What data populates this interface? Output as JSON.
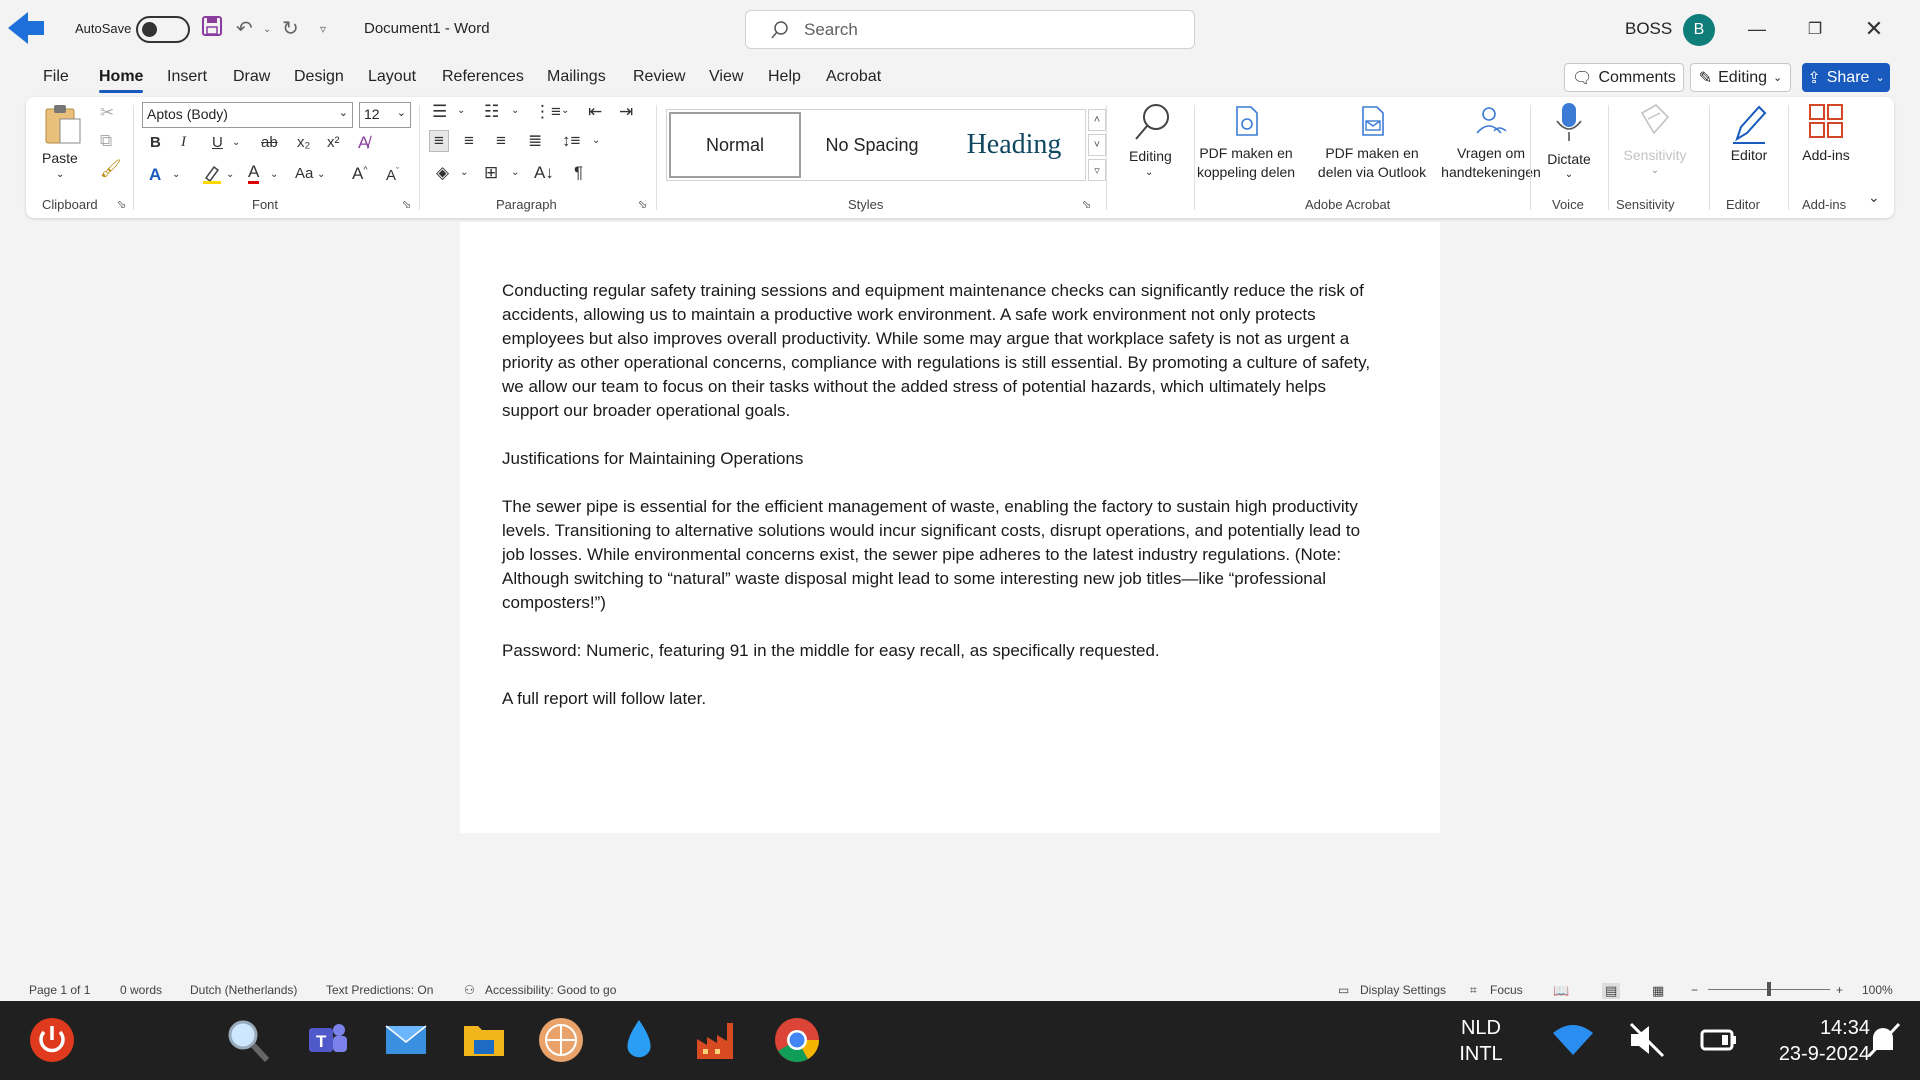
{
  "app": {
    "autosave_label": "AutoSave",
    "doc_title": "Document1  -  Word",
    "search_placeholder": "Search",
    "user_name": "BOSS",
    "user_initial": "B"
  },
  "menu": {
    "tabs": [
      "File",
      "Home",
      "Insert",
      "Draw",
      "Design",
      "Layout",
      "References",
      "Mailings",
      "Review",
      "View",
      "Help",
      "Acrobat"
    ],
    "active_tab": "Home",
    "comments_label": "Comments",
    "editing_label": "Editing",
    "share_label": "Share"
  },
  "ribbon": {
    "clipboard": {
      "paste_label": "Paste",
      "group_label": "Clipboard"
    },
    "font": {
      "font_name": "Aptos (Body)",
      "font_size": "12",
      "group_label": "Font",
      "change_case": "Aa"
    },
    "paragraph": {
      "group_label": "Paragraph"
    },
    "styles": {
      "items": [
        "Normal",
        "No Spacing",
        "Heading"
      ],
      "group_label": "Styles"
    },
    "editing": {
      "label": "Editing"
    },
    "acrobat": {
      "btn1_line1": "PDF maken en",
      "btn1_line2": "koppeling delen",
      "btn2_line1": "PDF maken en",
      "btn2_line2": "delen via Outlook",
      "btn3_line1": "Vragen om",
      "btn3_line2": "handtekeningen",
      "group_label": "Adobe Acrobat"
    },
    "voice": {
      "dictate_label": "Dictate",
      "group_label": "Voice"
    },
    "sensitivity": {
      "label": "Sensitivity",
      "group_label": "Sensitivity"
    },
    "editor": {
      "label": "Editor",
      "group_label": "Editor"
    },
    "addins": {
      "label": "Add-ins",
      "group_label": "Add-ins"
    }
  },
  "document": {
    "paragraphs": [
      "Conducting regular safety training sessions and equipment maintenance checks can significantly reduce the risk of accidents, allowing us to maintain a productive work environment. A safe work environment not only protects employees but also improves overall productivity. While some may argue that workplace safety is not as urgent a priority as other operational concerns, compliance with regulations is still essential. By promoting a culture of safety, we allow our team to focus on their tasks without the added stress of potential hazards, which ultimately helps support our broader operational goals.",
      "Justifications for Maintaining Operations",
      "The sewer pipe is essential for the efficient management of waste, enabling the factory to sustain high productivity levels. Transitioning to alternative solutions would incur significant costs, disrupt operations, and potentially lead to job losses. While environmental concerns exist, the sewer pipe adheres to the latest industry regulations. (Note: Although switching to “natural” waste disposal might lead to some interesting new job  titles—like “professional composters!”)",
      "Password: Numeric, featuring 91 in the middle for easy recall, as specifically requested.",
      "A full report will follow later."
    ]
  },
  "status": {
    "page": "Page 1 of 1",
    "words": "0 words",
    "language": "Dutch (Netherlands)",
    "predictions": "Text Predictions: On",
    "accessibility": "Accessibility: Good to go",
    "display_settings": "Display Settings",
    "focus": "Focus",
    "zoom": "100%"
  },
  "taskbar": {
    "lang_line1": "NLD",
    "lang_line2": "INTL",
    "time": "14:34",
    "date": "23-9-2024"
  },
  "colors": {
    "accent": "#185abd",
    "avatar": "#0f7d7a",
    "taskbar": "#202020"
  }
}
